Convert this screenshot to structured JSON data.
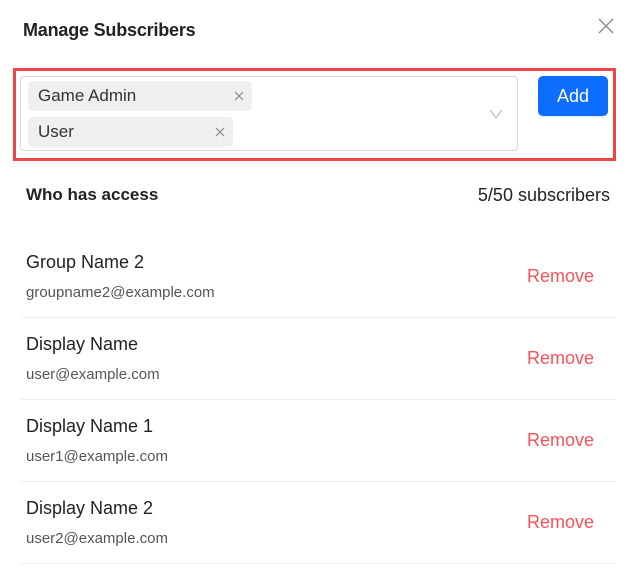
{
  "dialog": {
    "title": "Manage Subscribers",
    "close_icon": "close-icon"
  },
  "selector": {
    "selected_tags": [
      {
        "label": "Game Admin"
      },
      {
        "label": "User"
      }
    ],
    "dropdown_icon": "chevron-down-icon",
    "add_label": "Add",
    "highlight_color": "#ec4646",
    "add_color": "#0d6efd"
  },
  "access": {
    "heading": "Who has access",
    "count_text": "5/50 subscribers",
    "remove_color": "#f5525a",
    "subscribers": [
      {
        "name": "Group Name 2",
        "email": "groupname2@example.com",
        "action": "Remove"
      },
      {
        "name": "Display Name",
        "email": "user@example.com",
        "action": "Remove"
      },
      {
        "name": "Display Name 1",
        "email": "user1@example.com",
        "action": "Remove"
      },
      {
        "name": "Display Name 2",
        "email": "user2@example.com",
        "action": "Remove"
      }
    ]
  }
}
